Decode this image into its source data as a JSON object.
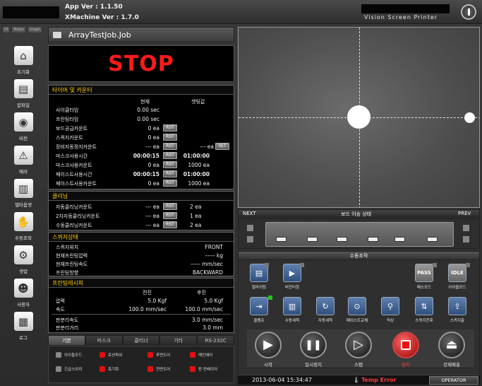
{
  "header": {
    "app_ver": "App Ver : 1.1.50",
    "xmachine_ver": "XMachine Ver : 1.7.0",
    "product": "Vision Screen Printer"
  },
  "tiny_tabs": [
    "IO",
    "Motor",
    "Graph"
  ],
  "nav": [
    {
      "label": "초기화",
      "icon": "home-icon",
      "glyph": "⌂"
    },
    {
      "label": "잡파일",
      "icon": "folder-icon",
      "glyph": "▤"
    },
    {
      "label": "비전",
      "icon": "camera-icon",
      "glyph": "◉"
    },
    {
      "label": "에러",
      "icon": "warning-icon",
      "glyph": "⚠"
    },
    {
      "label": "델타옵셋",
      "icon": "ruler-icon",
      "glyph": "▥"
    },
    {
      "label": "수동조작",
      "icon": "hand-icon",
      "glyph": "✋"
    },
    {
      "label": "셋업",
      "icon": "gear-icon",
      "glyph": "⚙"
    },
    {
      "label": "사용자",
      "icon": "user-icon",
      "glyph": "☻"
    },
    {
      "label": "로그",
      "icon": "log-icon",
      "glyph": "▦"
    }
  ],
  "job": {
    "name": "ArrayTestJob.Job"
  },
  "status_text": "STOP",
  "timer": {
    "title": "타이머 및 카운터",
    "col_current": "현재",
    "col_set": "셋팅값",
    "rows": [
      {
        "label": "사이클타임",
        "current": "0.00 sec",
        "set": ""
      },
      {
        "label": "프린팅타임",
        "current": "0.00 sec",
        "set": ""
      },
      {
        "label": "보드공급카운트",
        "current": "0 ea",
        "set": ""
      },
      {
        "label": "스퀴지카운트",
        "current": "0 ea",
        "set": ""
      },
      {
        "label": "장비자동정지카운트",
        "current": "--- ea",
        "set": "--- ea"
      },
      {
        "label": "마스크사용시간",
        "current": "00:00:15",
        "set": "01:00:00"
      },
      {
        "label": "마스크사용카운트",
        "current": "0 ea",
        "set": "1000 ea"
      },
      {
        "label": "페이스트사용시간",
        "current": "00:00:15",
        "set": "01:00:00"
      },
      {
        "label": "페이스트사용카운트",
        "current": "0 ea",
        "set": "1000 ea"
      }
    ],
    "rst_label": "RST",
    "set_label": "SET"
  },
  "cleaning": {
    "title": "클리닝",
    "rows": [
      {
        "label": "자동클리닝카운트",
        "current": "--- ea",
        "set": "2 ea"
      },
      {
        "label": "2차자동클리닝카운트",
        "current": "--- ea",
        "set": "1 ea"
      },
      {
        "label": "수동클리닝카운트",
        "current": "--- ea",
        "set": "2 ea"
      }
    ]
  },
  "squeegee": {
    "title": "스퀴지상태",
    "rows": [
      {
        "label": "스퀴지위치",
        "value": "FRONT"
      },
      {
        "label": "현재프린팅압력",
        "value": "----- kg"
      },
      {
        "label": "현재프린팅속도",
        "value": "----- mm/sec"
      },
      {
        "label": "프린팅방향",
        "value": "BACKWARD"
      }
    ]
  },
  "recipe": {
    "title": "프린팅레시피",
    "col_front": "전진",
    "col_back": "후진",
    "rows": [
      {
        "label": "압력",
        "front": "5.0 Kgf",
        "back": "5.0 Kgf"
      },
      {
        "label": "속도",
        "front": "100.0 mm/sec",
        "back": "100.0 mm/sec"
      }
    ],
    "rows2": [
      {
        "label": "판분리속도",
        "value": "3.0 mm/sec"
      },
      {
        "label": "판분리거리",
        "value": "3.0 mm"
      }
    ]
  },
  "bottom_tabs": [
    "기본",
    "마스크",
    "클리너",
    "기타",
    "RS-232C"
  ],
  "io": [
    {
      "label": "아이들모드",
      "color": "gray"
    },
    {
      "label": "로션파워",
      "color": "red"
    },
    {
      "label": "후면도어",
      "color": "red"
    },
    {
      "label": "메인에어",
      "color": "red"
    },
    {
      "label": "긴급스위치",
      "color": "gray"
    },
    {
      "label": "축기화",
      "color": "red"
    },
    {
      "label": "전면도어",
      "color": "red"
    },
    {
      "label": "윈 컨베이어",
      "color": "red"
    }
  ],
  "board": {
    "next": "NEXT",
    "title": "보드 이송 상태",
    "prev": "PREV"
  },
  "manual": {
    "title": "수동조작",
    "row1": [
      {
        "label": "얼라이팅",
        "icon": "align-icon",
        "glyph": "▤"
      },
      {
        "label": "비전티칭",
        "icon": "camera-teach-icon",
        "glyph": "▶"
      },
      {
        "label": "패스모드",
        "icon": "pass-mode-icon",
        "glyph": "PASS",
        "gray": true
      },
      {
        "label": "아이들모드",
        "icon": "idle-mode-icon",
        "glyph": "IDLE",
        "gray": true
      }
    ],
    "row2": [
      {
        "label": "클램프",
        "icon": "clamp-icon",
        "glyph": "⇥"
      },
      {
        "label": "수동세척",
        "icon": "manual-clean-icon",
        "glyph": "▥"
      },
      {
        "label": "자동세척",
        "icon": "auto-clean-icon",
        "glyph": "↻"
      },
      {
        "label": "페이스트교체",
        "icon": "paste-change-icon",
        "glyph": "⊙"
      },
      {
        "label": "믹싱",
        "icon": "mixing-icon",
        "glyph": "⚲"
      },
      {
        "label": "스퀴지전후",
        "icon": "squeegee-move-icon",
        "glyph": "⇅"
      },
      {
        "label": "스퀴지출",
        "icon": "squeegee-out-icon",
        "glyph": "⇪"
      }
    ],
    "actions": [
      {
        "label": "시작",
        "icon": "play-icon"
      },
      {
        "label": "일시정지",
        "icon": "pause-icon"
      },
      {
        "label": "스텝",
        "icon": "step-icon"
      },
      {
        "label": "정지",
        "icon": "stop-icon"
      },
      {
        "label": "강제배출",
        "icon": "eject-icon"
      }
    ]
  },
  "status_bar": {
    "datetime": "2013-06-04 15:34:47",
    "temp_error": "Temp Error",
    "operator": "OPERATOR"
  }
}
